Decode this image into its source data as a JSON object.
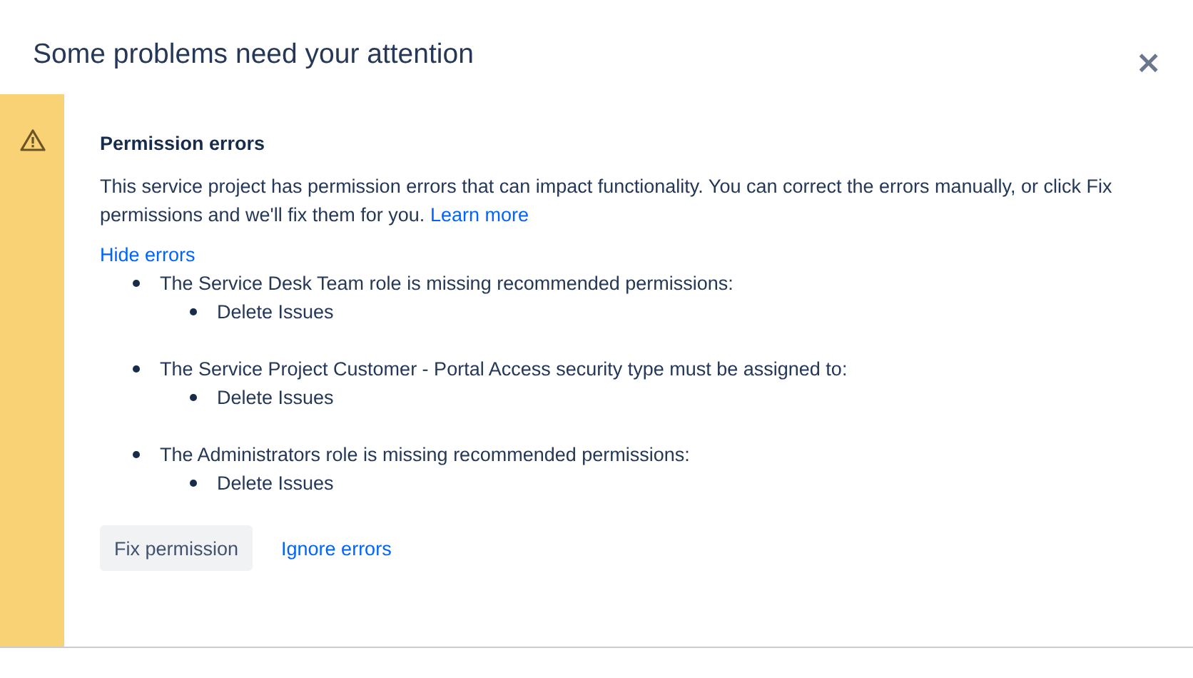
{
  "dialog": {
    "title": "Some problems need your attention",
    "close": "×"
  },
  "warning": {
    "heading": "Permission errors",
    "description": "This service project has permission errors that can impact functionality. You can correct the errors manually, or click Fix permissions and we'll fix them for you.",
    "learn_more": "Learn more",
    "toggle": "Hide errors",
    "errors": [
      {
        "text": "The Service Desk Team role is missing recommended permissions:",
        "children": [
          {
            "text": "Delete Issues"
          }
        ]
      },
      {
        "text": "The Service Project Customer - Portal Access security type must be assigned to:",
        "children": [
          {
            "text": "Delete Issues"
          }
        ]
      },
      {
        "text": "The Administrators role is missing recommended permissions:",
        "children": [
          {
            "text": "Delete Issues"
          }
        ]
      }
    ],
    "buttons": [
      {
        "label": "Fix permission",
        "kind": "secondary"
      },
      {
        "label": "Ignore errors",
        "kind": "link"
      }
    ]
  }
}
